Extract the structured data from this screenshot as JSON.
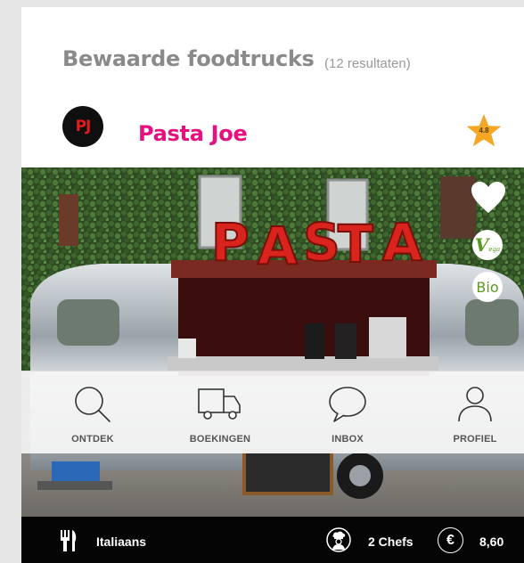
{
  "header": {
    "title": "Bewaarde foodtrucks",
    "result_count": "(12 resultaten)"
  },
  "truck": {
    "logo_text": "PJ",
    "name": "Pasta Joe",
    "rating": "4.8",
    "sign_letters": [
      "P",
      "A",
      "S",
      "T",
      "A"
    ],
    "badges": {
      "vega_main": "V",
      "vega_sub": "ega",
      "bio": "Bio"
    }
  },
  "nav": {
    "items": [
      {
        "label": "ONTDEK",
        "icon": "search-icon"
      },
      {
        "label": "BOEKINGEN",
        "icon": "truck-icon"
      },
      {
        "label": "INBOX",
        "icon": "chat-bubble-icon"
      },
      {
        "label": "PROFIEL",
        "icon": "user-icon"
      }
    ]
  },
  "info": {
    "cuisine": "Italiaans",
    "chefs": "2 Chefs",
    "currency_symbol": "€",
    "price": "8,60"
  },
  "colors": {
    "accent": "#e4127e",
    "star": "#f5a623",
    "title_gray": "#8a8a8a",
    "badge_green": "#5a9a1e",
    "info_bar": "#050505"
  }
}
